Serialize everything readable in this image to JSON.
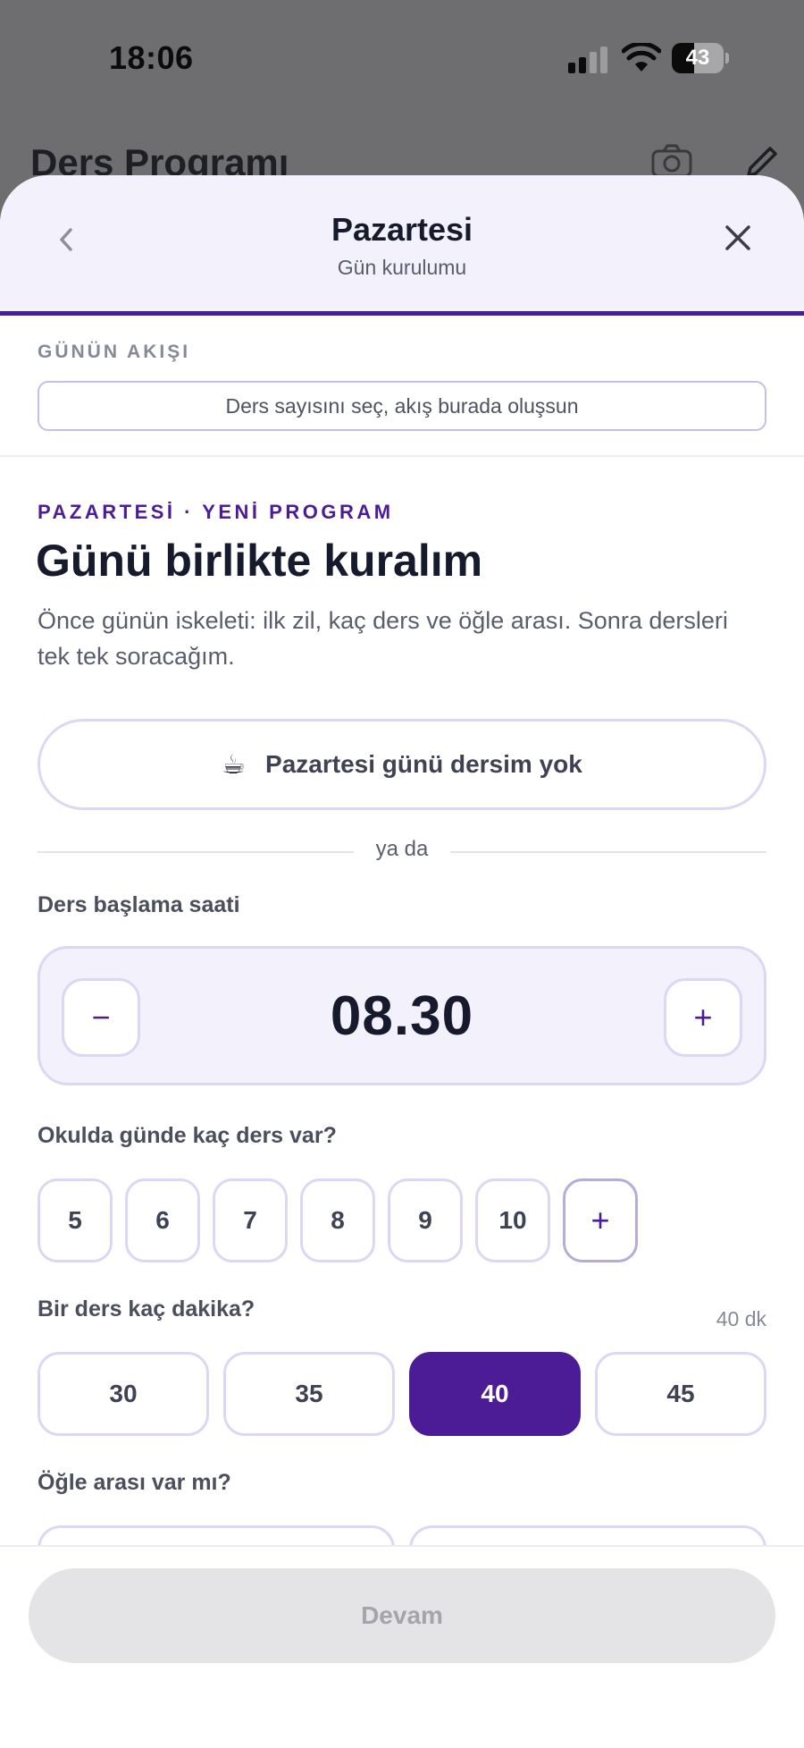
{
  "status_bar": {
    "time": "18:06",
    "battery": "43",
    "battery_level": 0.43
  },
  "background_app": {
    "title": "Ders Programı",
    "icons": [
      "camera-icon",
      "pencil-icon"
    ]
  },
  "sheet": {
    "title": "Pazartesi",
    "subtitle": "Gün kurulumu",
    "flow": {
      "label": "GÜNÜN AKIŞI",
      "placeholder": "Ders sayısını seç, akış burada oluşsun"
    },
    "eyebrow": "PAZARTESİ · YENİ PROGRAM",
    "heading": "Günü birlikte kuralım",
    "intro": "Önce günün iskeleti: ilk zil, kaç ders ve öğle arası. Sonra dersleri tek tek soracağım.",
    "no_class": {
      "icon": "☕",
      "label": "Pazartesi günü dersim yok"
    },
    "or_text": "ya da",
    "start_time": {
      "label": "Ders başlama saati",
      "value": "08.30",
      "minus": "−",
      "plus": "+"
    },
    "class_count": {
      "label": "Okulda günde kaç ders var?",
      "options": [
        "5",
        "6",
        "7",
        "8",
        "9",
        "10"
      ],
      "add": "+"
    },
    "duration": {
      "label": "Bir ders kaç dakika?",
      "current": "40 dk",
      "options": [
        "30",
        "35",
        "40",
        "45"
      ],
      "selected": "40"
    },
    "lunch": {
      "label": "Öğle arası var mı?"
    },
    "continue_label": "Devam"
  },
  "colors": {
    "accent": "#4b1c96",
    "header_bg": "#f3f1fc",
    "border": "#ddd6f4",
    "disabled_bg": "#e4e4e6"
  }
}
